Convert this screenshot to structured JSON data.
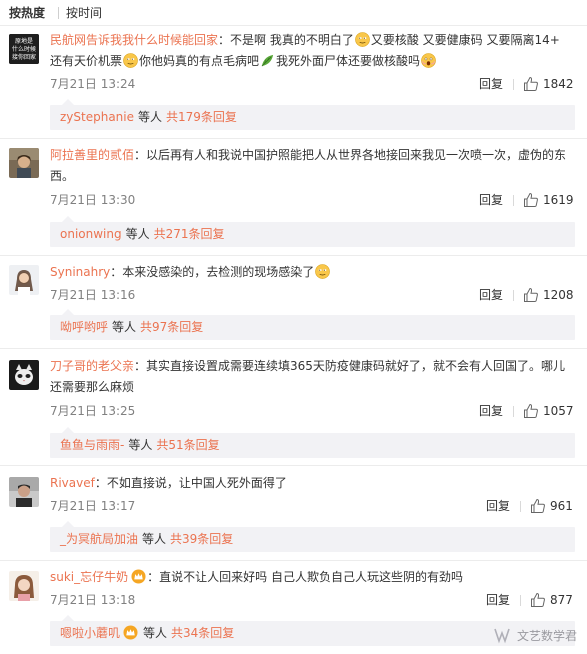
{
  "sort": {
    "hot": "按热度",
    "time": "按时间"
  },
  "comments": [
    {
      "user": "民航网告诉我我什么时候能回家",
      "avatar_text": [
        "原地是",
        "什么时候",
        "接你回家"
      ],
      "text_parts": [
        "不是啊 我真的不明白了",
        "又要核酸 又要健康码 又要隔离14+ 还有天价机票",
        "你他妈真的有点毛病吧",
        "我死外面尸体还要做核酸吗"
      ],
      "date": "7月21日 13:24",
      "reply": "回复",
      "likes": "1842",
      "sub_user": "zyStephanie",
      "sub_etc": "等人",
      "sub_total": "共179条回复"
    },
    {
      "user": "阿拉善里的贰佰",
      "text": "以后再有人和我说中国护照能把人从世界各地接回来我见一次喷一次，虚伪的东西。",
      "date": "7月21日 13:30",
      "reply": "回复",
      "likes": "1619",
      "sub_user": "onionwing",
      "sub_etc": "等人",
      "sub_total": "共271条回复"
    },
    {
      "user": "Syninahry",
      "text": "本来没感染的，去检测的现场感染了",
      "date": "7月21日 13:16",
      "reply": "回复",
      "likes": "1208",
      "sub_user": "呦呼哟呼",
      "sub_etc": "等人",
      "sub_total": "共97条回复"
    },
    {
      "user": "刀子哥的老父亲",
      "text": "其实直接设置成需要连续填365天防疫健康码就好了，就不会有人回国了。哪儿还需要那么麻烦",
      "date": "7月21日 13:25",
      "reply": "回复",
      "likes": "1057",
      "sub_user": "鱼鱼与雨雨-",
      "sub_etc": "等人",
      "sub_total": "共51条回复"
    },
    {
      "user": "Rivavef",
      "text": "不如直接说，让中国人死外面得了",
      "date": "7月21日 13:17",
      "reply": "回复",
      "likes": "961",
      "sub_user": "_为冥航局加油",
      "sub_etc": "等人",
      "sub_total": "共39条回复"
    },
    {
      "user": "suki_忘仔牛奶",
      "text": "直说不让人回来好吗 自己人欺负自己人玩这些阴的有劲吗",
      "date": "7月21日 13:18",
      "reply": "回复",
      "likes": "877",
      "sub_user": "嗯啦小蘑叽",
      "sub_etc": "等人",
      "sub_total": "共34条回复"
    }
  ],
  "watermark": "文艺数学君",
  "colors": {
    "link": "#eb7350",
    "meta": "#808080",
    "subbox": "#f2f2f5"
  },
  "icons": {
    "like": "thumbs-up-icon",
    "emoji": "smiley-emoji-icon",
    "leaf": "leaf-emoji-icon",
    "scream": "scream-emoji-icon",
    "crown": "crown-badge-icon"
  }
}
